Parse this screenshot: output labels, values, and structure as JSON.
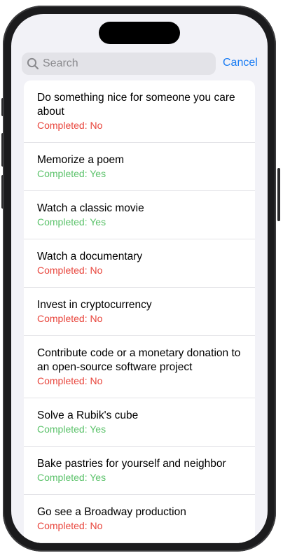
{
  "search": {
    "placeholder": "Search",
    "value": "",
    "cancel_label": "Cancel"
  },
  "colors": {
    "accent": "#1a7cf3",
    "completed_no": "#e8453c",
    "completed_yes": "#5bc26a"
  },
  "tasks": [
    {
      "title": "Do something nice for someone you care about",
      "status": "Completed: No",
      "completed": false
    },
    {
      "title": "Memorize a poem",
      "status": "Completed: Yes",
      "completed": true
    },
    {
      "title": "Watch a classic movie",
      "status": "Completed: Yes",
      "completed": true
    },
    {
      "title": "Watch a documentary",
      "status": "Completed: No",
      "completed": false
    },
    {
      "title": "Invest in cryptocurrency",
      "status": "Completed: No",
      "completed": false
    },
    {
      "title": "Contribute code or a monetary donation to an open-source software project",
      "status": "Completed: No",
      "completed": false
    },
    {
      "title": "Solve a Rubik's cube",
      "status": "Completed: Yes",
      "completed": true
    },
    {
      "title": "Bake pastries for yourself and neighbor",
      "status": "Completed: Yes",
      "completed": true
    },
    {
      "title": "Go see a Broadway production",
      "status": "Completed: No",
      "completed": false
    }
  ]
}
